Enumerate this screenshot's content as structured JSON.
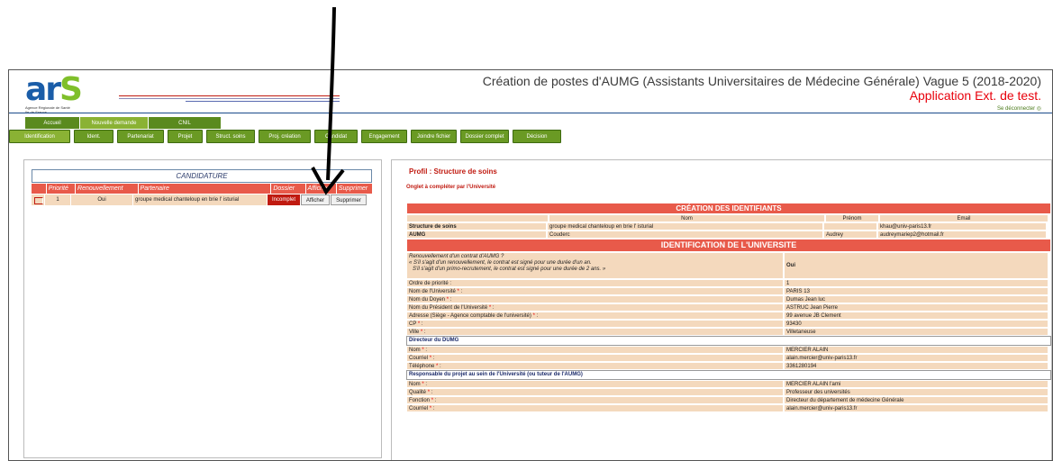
{
  "header": {
    "logo_text": "ars",
    "logo_sub1": "Agence Régionale de Santé",
    "logo_sub2": "Ile-de-France",
    "title": "Création de postes d'AUMG (Assistants Universitaires de Médecine Générale) Vague 5 (2018-2020)",
    "subtitle": "Application Ext. de test.",
    "logout": "Se déconnecter"
  },
  "main_tabs": [
    "Accueil",
    "Nouvelle demande",
    "CNIL"
  ],
  "sub_tabs": [
    "Identification",
    "Ident.",
    "Partenariat",
    "Projet",
    "Struct. soins",
    "Proj. création",
    "Candidat",
    "Engagement",
    "Joindre fichier",
    "Dossier complet",
    "Décision"
  ],
  "candidature": {
    "title": "CANDIDATURE",
    "headers": [
      "Priorité",
      "Renouvellement",
      "Partenaire",
      "Dossier",
      "Afficher",
      "Supprimer"
    ],
    "row": {
      "priorite": "1",
      "renouvellement": "Oui",
      "partenaire": "groupe medical chanteloup en brie l' isturial",
      "dossier": "Incomplet",
      "afficher": "Afficher",
      "supprimer": "Supprimer"
    }
  },
  "profil": "Profil : Structure de soins",
  "onglet": "Onglet à compléter par l'Université",
  "creation": {
    "title": "CRÉATION DES IDENTIFIANTS",
    "col_nom": "Nom",
    "col_prenom": "Prénom",
    "col_email": "Email",
    "rows": [
      {
        "label": "Structure de soins",
        "nom": "groupe medical chanteloup en brie l' isturial",
        "prenom": "",
        "email": "khau@univ-paris13.fr"
      },
      {
        "label": "AUMG",
        "nom": "Couderc",
        "prenom": "Audrey",
        "email": "audreymariep2@hotmail.fr"
      }
    ]
  },
  "universite": {
    "title": "IDENTIFICATION DE L'UNIVERSITE",
    "renouv_q": "Renouvellement d'un contrat d'AUMG ?",
    "renouv_n1": "« S'il s'agit d'un renouvellement, le contrat est signé pour une durée d'un an.",
    "renouv_n2": "S'il s'agit d'un primo-recrutement, le contrat est signé pour une durée de 2 ans. »",
    "renouv_val": "Oui",
    "fields": [
      {
        "label": "Ordre de priorité :",
        "req": false,
        "value": "1"
      },
      {
        "label": "Nom de l'Université",
        "req": true,
        "value": "PARIS 13"
      },
      {
        "label": "Nom du Doyen",
        "req": true,
        "value": "Dumas Jean luc"
      },
      {
        "label": "Nom du Président de l'Université",
        "req": true,
        "value": "ASTRUC Jean Pierre"
      },
      {
        "label": "Adresse (Siège - Agence comptable de l'université)",
        "req": true,
        "value": "99 avenue JB Clement"
      },
      {
        "label": "CP",
        "req": true,
        "value": "93430"
      },
      {
        "label": "Ville",
        "req": true,
        "value": "Villetaneuse"
      }
    ],
    "dumg_title": "Directeur du DUMG",
    "dumg": [
      {
        "label": "Nom",
        "value": "MERCIER ALAIN"
      },
      {
        "label": "Courriel",
        "value": "alain.mercier@univ-paris13.fr"
      },
      {
        "label": "Téléphone",
        "value": "3361280194"
      }
    ],
    "resp_title": "Responsable du projet au sein de l'Université (ou tuteur de l'AUMG)",
    "resp": [
      {
        "label": "Nom",
        "value": "MERCIER ALAIN l'ami"
      },
      {
        "label": "Qualité",
        "value": "Professeur des universités"
      },
      {
        "label": "Fonction",
        "value": "Directeur du département de médecine Générale"
      },
      {
        "label": "Courriel",
        "value": "alain.mercier@univ-paris13.fr"
      }
    ]
  },
  "colors": {
    "accent_red": "#e85a4a",
    "green": "#6a9a24",
    "title_blue": "#1a4a8a"
  }
}
